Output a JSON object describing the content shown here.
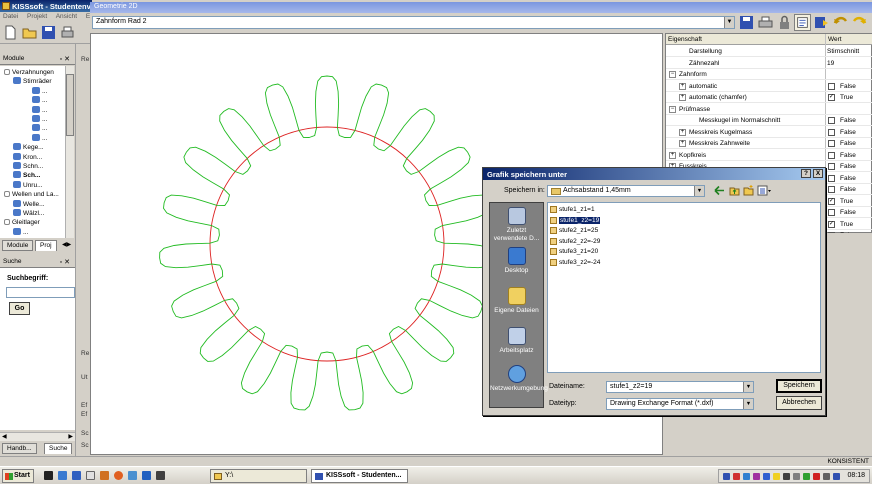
{
  "app": {
    "title": "KISSsoft - Studentenv",
    "menu": [
      "Datei",
      "Projekt",
      "Ansicht",
      "E"
    ]
  },
  "modules_panel": {
    "title": "Module",
    "tree": [
      {
        "label": "Verzahnungen",
        "depth": 0
      },
      {
        "label": "Stirnräder",
        "depth": 1
      },
      {
        "label": "...",
        "depth": 2
      },
      {
        "label": "...",
        "depth": 2
      },
      {
        "label": "...",
        "depth": 2
      },
      {
        "label": "...",
        "depth": 2
      },
      {
        "label": "...",
        "depth": 2
      },
      {
        "label": "...",
        "depth": 2
      },
      {
        "label": "Kege...",
        "depth": 1
      },
      {
        "label": "Kron...",
        "depth": 1
      },
      {
        "label": "Schn...",
        "depth": 1
      },
      {
        "label": "Sch...",
        "depth": 1,
        "selected": true
      },
      {
        "label": "Unru...",
        "depth": 1
      },
      {
        "label": "Wellen und La...",
        "depth": 0
      },
      {
        "label": "Welle...",
        "depth": 1
      },
      {
        "label": "Wälzl...",
        "depth": 1
      },
      {
        "label": "Gleitlager",
        "depth": 0
      },
      {
        "label": "...",
        "depth": 1
      }
    ],
    "tabs": [
      "Module",
      "Proj"
    ]
  },
  "search_panel": {
    "title": "Suche",
    "label": "Suchbegriff:",
    "value": "",
    "go": "Go",
    "tabs": [
      "Handb...",
      "Suche"
    ]
  },
  "middle_strip": [
    "Re",
    "Re",
    "Ut",
    "Ef",
    "Ef",
    "Sc",
    "Sc"
  ],
  "geometry_window": {
    "title": "Geometrie 2D",
    "combo_value": "Zahnform Rad 2"
  },
  "properties": {
    "header_name": "Eigenschaft",
    "header_value": "Wert",
    "rows": [
      {
        "name": "Darstellung",
        "value": "Stirnschnitt",
        "indent": 1
      },
      {
        "name": "Zähnezahl",
        "value": "19",
        "indent": 1
      },
      {
        "name": "Zahnform",
        "group": true,
        "indent": 0
      },
      {
        "name": "automatic",
        "check": false,
        "value": "False",
        "indent": 1,
        "plus": true
      },
      {
        "name": "automatic (chamfer)",
        "check": true,
        "value": "True",
        "indent": 1,
        "plus": true
      },
      {
        "name": "Prüfmasse",
        "group": true,
        "indent": 0
      },
      {
        "name": "Messkugel im Normalschnitt",
        "check": false,
        "value": "False",
        "indent": 2
      },
      {
        "name": "Messkreis Kugelmass",
        "check": false,
        "value": "False",
        "indent": 1,
        "plus": true
      },
      {
        "name": "Messkreis Zahnweite",
        "check": false,
        "value": "False",
        "indent": 1,
        "plus": true
      },
      {
        "name": "Kopfkreis",
        "check": false,
        "value": "False",
        "indent": 0,
        "plus": true
      },
      {
        "name": "Fusskreis",
        "check": false,
        "value": "False",
        "indent": 0,
        "plus": true
      },
      {
        "name": "",
        "check": false,
        "value": "False",
        "indent": 0
      },
      {
        "name": "",
        "check": false,
        "value": "False",
        "indent": 0
      },
      {
        "name": "",
        "check": true,
        "value": "True",
        "indent": 0
      },
      {
        "name": "",
        "check": false,
        "value": "False",
        "indent": 0
      },
      {
        "name": "",
        "check": true,
        "value": "True",
        "indent": 0
      },
      {
        "name": "",
        "check": false,
        "value": "False",
        "indent": 0
      }
    ]
  },
  "gear": {
    "teeth": 19,
    "profile_color": "#22bb22",
    "circle_color": "#dd2222"
  },
  "save_dialog": {
    "title": "Grafik speichern unter",
    "help": "?",
    "close": "X",
    "save_in_label": "Speichern in:",
    "save_in_value": "Achsabstand 1,45mm",
    "places": [
      "Zuletzt verwendete D...",
      "Desktop",
      "Eigene Dateien",
      "Arbeitsplatz",
      "Netzwerkumgebung"
    ],
    "files": [
      "stufe1_z1=1",
      "stufe1_z2=19",
      "stufe2_z1=25",
      "stufe2_z2=-29",
      "stufe3_z1=20",
      "stufe3_z2=-24"
    ],
    "selected_file": "stufe1_z2=19",
    "filename_label": "Dateiname:",
    "filename_value": "stufe1_z2=19",
    "filetype_label": "Dateityp:",
    "filetype_value": "Drawing Exchange Format (*.dxf)",
    "save_button": "Speichern",
    "cancel_button": "Abbrechen"
  },
  "status": {
    "text": "KONSISTENT"
  },
  "taskbar": {
    "start": "Start",
    "tasks": [
      "Y:\\",
      "KISSsoft - Studenten..."
    ],
    "clock": "08:18"
  }
}
